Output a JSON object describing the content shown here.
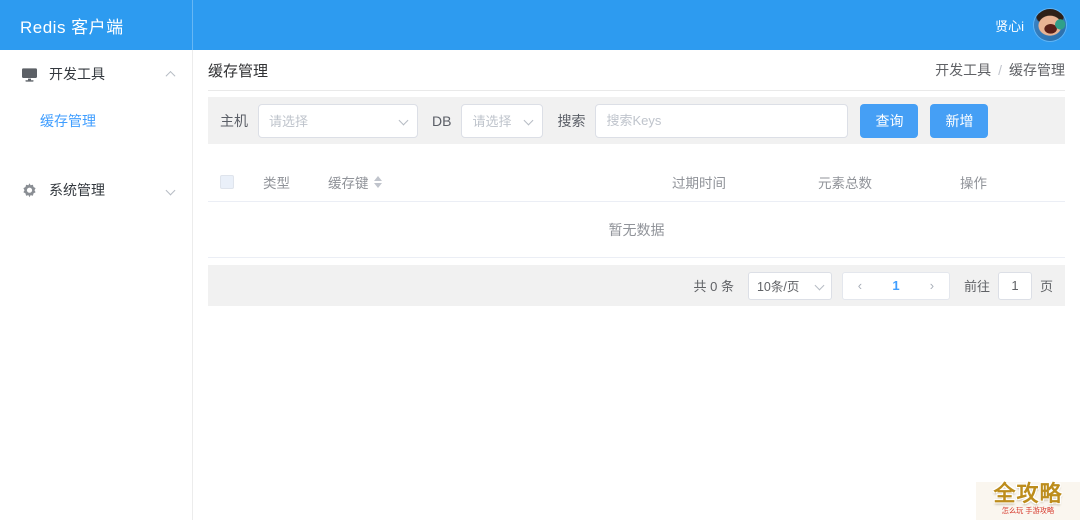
{
  "app": {
    "title": "Redis 客户端",
    "username": "贤心i"
  },
  "colors": {
    "topbar": "#2D9BF0",
    "primary": "#409EFF",
    "button": "#459FF5",
    "strip_bg": "#F1F1F1",
    "border": "#EBEEF5",
    "muted_text": "#909399",
    "placeholder": "#BFC4CC",
    "watermark_gold": "#BD8D1C",
    "watermark_red": "#D6392C"
  },
  "sidebar": {
    "groups": [
      {
        "label": "开发工具",
        "icon": "monitor-icon",
        "expanded": true,
        "children": [
          {
            "label": "缓存管理",
            "active": true
          }
        ]
      },
      {
        "label": "系统管理",
        "icon": "gear-icon",
        "expanded": false,
        "children": []
      }
    ]
  },
  "header": {
    "title": "缓存管理",
    "breadcrumb": {
      "part1": "开发工具",
      "separator": "/",
      "part2": "缓存管理"
    }
  },
  "filters": {
    "host_label": "主机",
    "host_placeholder": "请选择",
    "db_label": "DB",
    "db_placeholder": "请选择",
    "search_label": "搜索",
    "search_placeholder": "搜索Keys",
    "query_button": "查询",
    "add_button": "新增"
  },
  "table": {
    "columns": [
      "类型",
      "缓存键",
      "过期时间",
      "元素总数",
      "操作"
    ],
    "empty_text": "暂无数据",
    "rows": []
  },
  "pagination": {
    "total_text": "共 0 条",
    "page_size": "10条/页",
    "prev_icon": "‹",
    "current_page": "1",
    "next_icon": "›",
    "goto_label": "前往",
    "goto_value": "1",
    "page_unit": "页"
  },
  "watermark": {
    "title": "全攻略",
    "subtitle": "怎么玩 手游攻略"
  }
}
